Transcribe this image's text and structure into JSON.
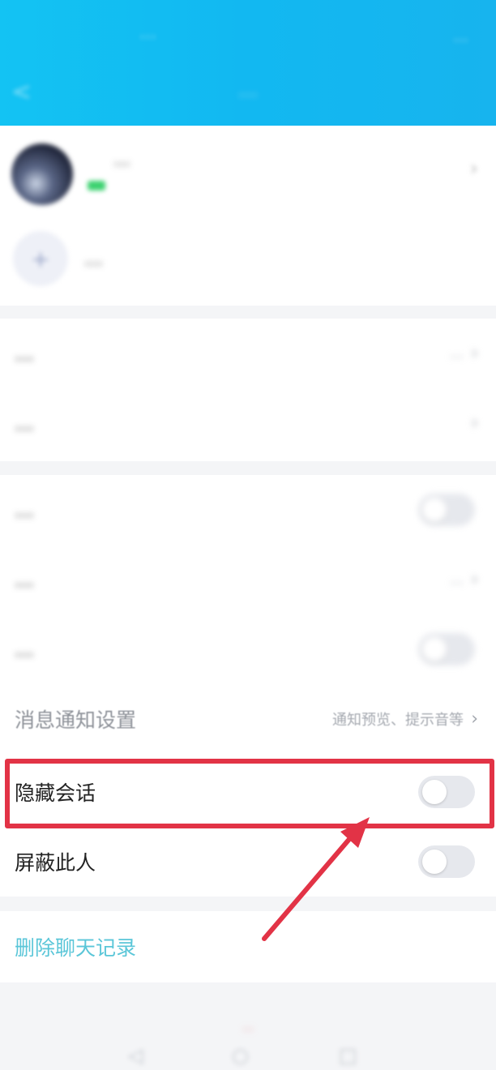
{
  "header": {
    "carrier_text": "...",
    "status_right": "...",
    "title": "...",
    "back_icon": "back-arrow-icon"
  },
  "profile": {
    "name": "...",
    "create_group_label": "...",
    "chevron_icon": "chevron-right-icon",
    "create_group_icon": "plus-icon"
  },
  "settings": {
    "chat_history_label": "...",
    "chat_history_value": "...",
    "chat_background_label": "...",
    "pin_label": "...",
    "special_care_label": "...",
    "special_care_value": "...",
    "do_not_disturb_label": "...",
    "notification_label": "消息通知设置",
    "notification_value": "通知预览、提示音等",
    "hide_chat_label": "隐藏会话",
    "hide_chat_on": false,
    "block_label": "屏蔽此人",
    "block_on": false,
    "delete_history_label": "删除聊天记录",
    "pin_on": false,
    "do_not_disturb_on": false
  },
  "footer": {
    "red_text": "..."
  },
  "colors": {
    "header_gradient": "#13c3f3",
    "highlight_border": "#e23346",
    "annotation_arrow": "#e23346",
    "delete_text": "#5ac6d8",
    "toggle_off": "#e6e8ed"
  }
}
